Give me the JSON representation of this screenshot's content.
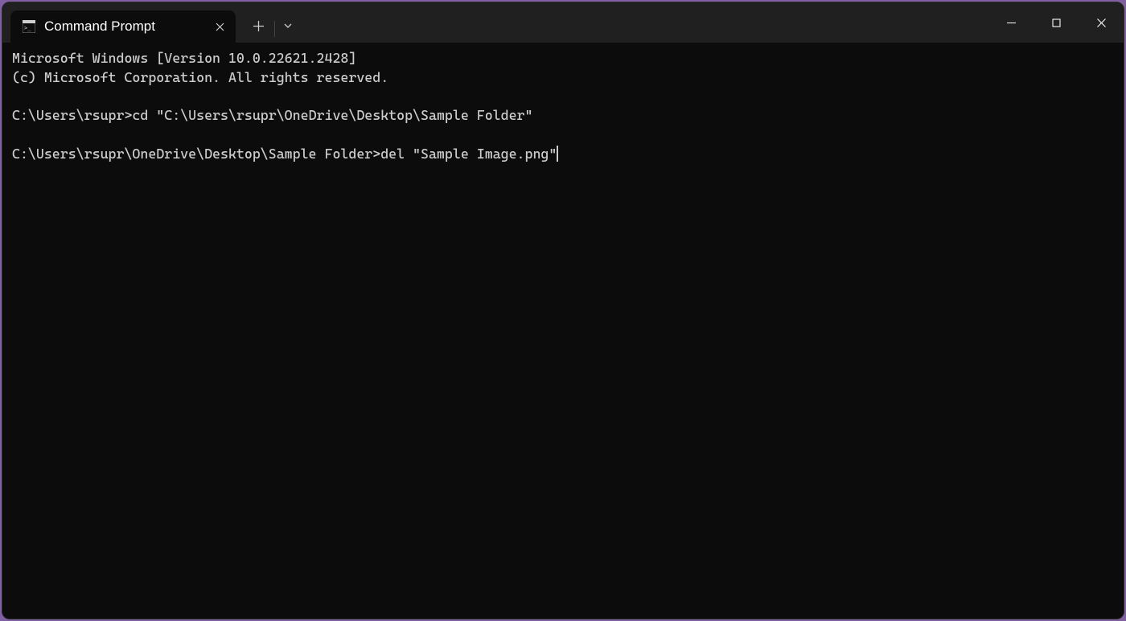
{
  "titlebar": {
    "tab_title": "Command Prompt"
  },
  "terminal": {
    "banner_line1": "Microsoft Windows [Version 10.0.22621.2428]",
    "banner_line2": "(c) Microsoft Corporation. All rights reserved.",
    "line1_prompt": "C:\\Users\\rsupr>",
    "line1_cmd": "cd \"C:\\Users\\rsupr\\OneDrive\\Desktop\\Sample Folder\"",
    "line2_prompt": "C:\\Users\\rsupr\\OneDrive\\Desktop\\Sample Folder>",
    "line2_cmd": "del \"Sample Image.png\""
  }
}
